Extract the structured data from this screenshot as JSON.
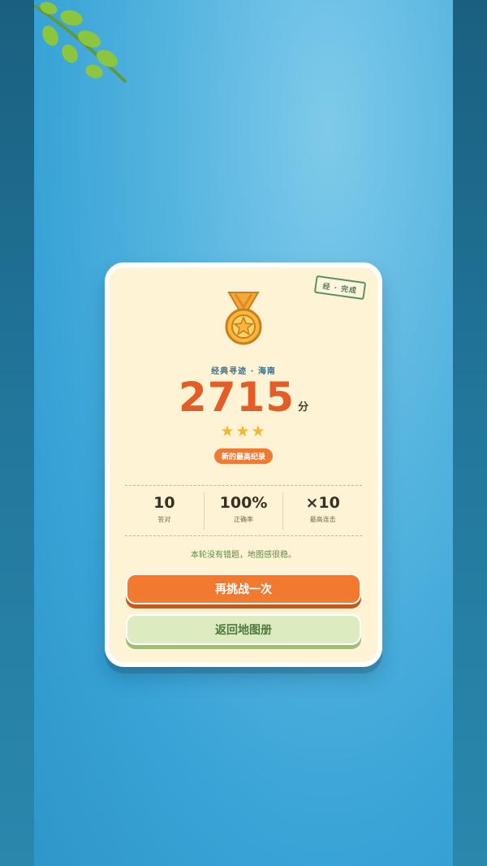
{
  "result": {
    "stamp": "经 · 完成",
    "subtitle": "经典寻迹 · 海南",
    "score": "2715",
    "score_unit": "分",
    "stars": "★★★",
    "star_count": 3,
    "badge": "新的最高纪录",
    "stats": [
      {
        "value": "10",
        "label": "答对"
      },
      {
        "value": "100%",
        "label": "正确率"
      },
      {
        "value": "×10",
        "label": "最高连击"
      }
    ],
    "note": "本轮没有错题，地图感很稳。",
    "retry_button": "再挑战一次",
    "back_button": "返回地图册"
  },
  "icons": {
    "medal": "medal-icon",
    "branch": "leaf-branch-decoration"
  },
  "colors": {
    "accent": "#f17a30",
    "score": "#e45c26",
    "card": "#fff3d6",
    "secondary_button": "#dcebc0",
    "background": "#3aa5d8"
  }
}
